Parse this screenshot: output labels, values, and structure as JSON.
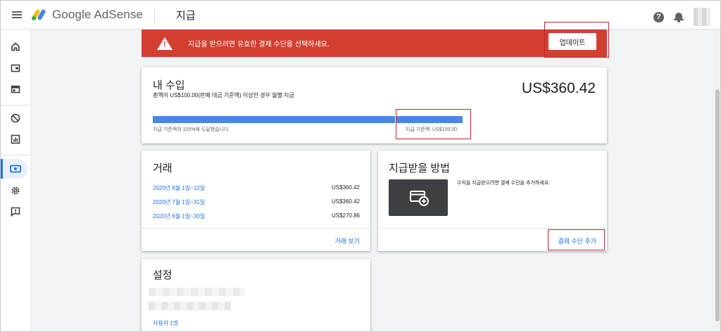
{
  "header": {
    "brand_prefix": "Google",
    "brand_name": "AdSense",
    "page_title": "지급"
  },
  "alert": {
    "message": "지급을 받으려면 유효한 결제 수단을 선택하세요.",
    "button_label": "업데이트",
    "color": "#d23f31"
  },
  "earnings": {
    "title": "내 수입",
    "threshold_text": "총액이 US$100.00(판매 대금 기준액) 이상인 경우 월별 지급",
    "amount": "US$360.42",
    "progress_fraction": 1.0,
    "progress_caption": "지급 기준액의 100%에 도달했습니다.",
    "threshold_caption": "지급 기준액: US$100.00"
  },
  "transactions": {
    "title": "거래",
    "rows": [
      {
        "period": "2020년 8월 1일~12일",
        "amount": "US$360.42"
      },
      {
        "period": "2020년 7월 1일~31일",
        "amount": "US$360.42"
      },
      {
        "period": "2020년 6월 1일~30일",
        "amount": "US$270.86"
      }
    ],
    "view_link": "거래 보기"
  },
  "payment_method": {
    "title": "지급받을 방법",
    "description": "수익을 지급받으려면 결제 수단을 추가하세요.",
    "add_link": "결제 수단 추가",
    "icon": "add-card-icon"
  },
  "settings": {
    "title": "설정",
    "users_link": "사용자 1명"
  },
  "colors": {
    "accent": "#1a73e8",
    "progress": "#4a86e8",
    "highlight_box": "#c0262c"
  }
}
